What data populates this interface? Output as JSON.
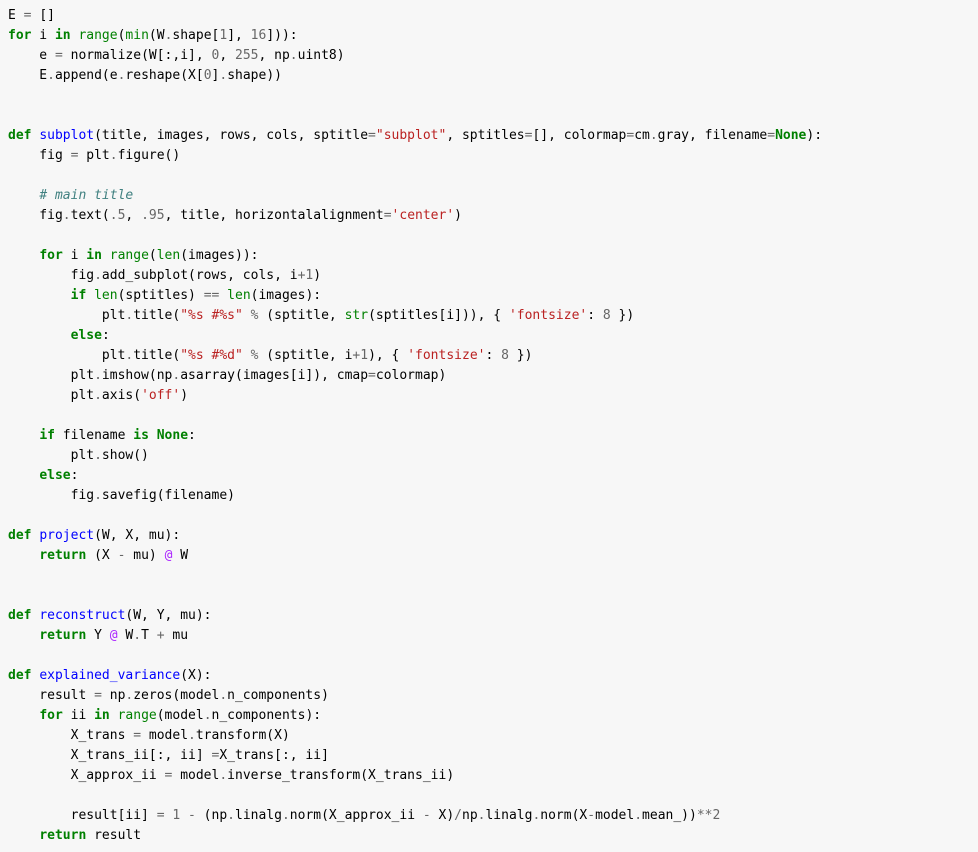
{
  "code": {
    "lines": [
      [
        [
          "",
          "E "
        ],
        [
          "op",
          "= "
        ],
        [
          "pun",
          "[]"
        ]
      ],
      [
        [
          "kw",
          "for"
        ],
        [
          "",
          " i "
        ],
        [
          "kw",
          "in"
        ],
        [
          "",
          " "
        ],
        [
          "bi",
          "range"
        ],
        [
          "pun",
          "("
        ],
        [
          "bi",
          "min"
        ],
        [
          "pun",
          "(W"
        ],
        [
          "op",
          "."
        ],
        [
          "pun",
          "shape["
        ],
        [
          "num",
          "1"
        ],
        [
          "pun",
          "], "
        ],
        [
          "num",
          "16"
        ],
        [
          "pun",
          "])):"
        ]
      ],
      [
        [
          "",
          "    e "
        ],
        [
          "op",
          "= "
        ],
        [
          "pun",
          "normalize(W[:,i], "
        ],
        [
          "num",
          "0"
        ],
        [
          "pun",
          ", "
        ],
        [
          "num",
          "255"
        ],
        [
          "pun",
          ", np"
        ],
        [
          "op",
          "."
        ],
        [
          "pun",
          "uint8)"
        ]
      ],
      [
        [
          "",
          "    E"
        ],
        [
          "op",
          "."
        ],
        [
          "pun",
          "append(e"
        ],
        [
          "op",
          "."
        ],
        [
          "pun",
          "reshape(X["
        ],
        [
          "num",
          "0"
        ],
        [
          "pun",
          "]"
        ],
        [
          "op",
          "."
        ],
        [
          "pun",
          "shape))"
        ]
      ],
      [
        [
          "",
          ""
        ]
      ],
      [
        [
          "",
          ""
        ]
      ],
      [
        [
          "kw",
          "def"
        ],
        [
          "",
          " "
        ],
        [
          "fun",
          "subplot"
        ],
        [
          "pun",
          "(title, images, rows, cols, sptitle"
        ],
        [
          "op",
          "="
        ],
        [
          "str",
          "\"subplot\""
        ],
        [
          "pun",
          ", sptitles"
        ],
        [
          "op",
          "="
        ],
        [
          "pun",
          "[], colormap"
        ],
        [
          "op",
          "="
        ],
        [
          "pun",
          "cm"
        ],
        [
          "op",
          "."
        ],
        [
          "pun",
          "gray, filename"
        ],
        [
          "op",
          "="
        ],
        [
          "cn",
          "None"
        ],
        [
          "pun",
          "):"
        ]
      ],
      [
        [
          "",
          "    fig "
        ],
        [
          "op",
          "= "
        ],
        [
          "pun",
          "plt"
        ],
        [
          "op",
          "."
        ],
        [
          "pun",
          "figure()"
        ]
      ],
      [
        [
          "",
          ""
        ]
      ],
      [
        [
          "",
          "    "
        ],
        [
          "com",
          "# main title"
        ]
      ],
      [
        [
          "",
          "    fig"
        ],
        [
          "op",
          "."
        ],
        [
          "pun",
          "text("
        ],
        [
          "num",
          ".5"
        ],
        [
          "pun",
          ", "
        ],
        [
          "num",
          ".95"
        ],
        [
          "pun",
          ", title, horizontalalignment"
        ],
        [
          "op",
          "="
        ],
        [
          "str",
          "'center'"
        ],
        [
          "pun",
          ")"
        ]
      ],
      [
        [
          "",
          ""
        ]
      ],
      [
        [
          "",
          "    "
        ],
        [
          "kw",
          "for"
        ],
        [
          "",
          " i "
        ],
        [
          "kw",
          "in"
        ],
        [
          "",
          " "
        ],
        [
          "bi",
          "range"
        ],
        [
          "pun",
          "("
        ],
        [
          "bi",
          "len"
        ],
        [
          "pun",
          "(images)):"
        ]
      ],
      [
        [
          "",
          "        fig"
        ],
        [
          "op",
          "."
        ],
        [
          "pun",
          "add_subplot(rows, cols, i"
        ],
        [
          "op",
          "+"
        ],
        [
          "num",
          "1"
        ],
        [
          "pun",
          ")"
        ]
      ],
      [
        [
          "",
          "        "
        ],
        [
          "kw",
          "if"
        ],
        [
          "",
          " "
        ],
        [
          "bi",
          "len"
        ],
        [
          "pun",
          "(sptitles) "
        ],
        [
          "op",
          "== "
        ],
        [
          "bi",
          "len"
        ],
        [
          "pun",
          "(images):"
        ]
      ],
      [
        [
          "",
          "            plt"
        ],
        [
          "op",
          "."
        ],
        [
          "pun",
          "title("
        ],
        [
          "str",
          "\"%s #%s\""
        ],
        [
          "",
          " "
        ],
        [
          "op",
          "%"
        ],
        [
          "",
          " (sptitle, "
        ],
        [
          "bi",
          "str"
        ],
        [
          "pun",
          "(sptitles[i])), { "
        ],
        [
          "str",
          "'fontsize'"
        ],
        [
          "pun",
          ": "
        ],
        [
          "num",
          "8"
        ],
        [
          "pun",
          " })"
        ]
      ],
      [
        [
          "",
          "        "
        ],
        [
          "kw",
          "else"
        ],
        [
          "pun",
          ":"
        ]
      ],
      [
        [
          "",
          "            plt"
        ],
        [
          "op",
          "."
        ],
        [
          "pun",
          "title("
        ],
        [
          "str",
          "\"%s #%d\""
        ],
        [
          "",
          " "
        ],
        [
          "op",
          "%"
        ],
        [
          "",
          " (sptitle, i"
        ],
        [
          "op",
          "+"
        ],
        [
          "num",
          "1"
        ],
        [
          "pun",
          "), { "
        ],
        [
          "str",
          "'fontsize'"
        ],
        [
          "pun",
          ": "
        ],
        [
          "num",
          "8"
        ],
        [
          "pun",
          " })"
        ]
      ],
      [
        [
          "",
          "        plt"
        ],
        [
          "op",
          "."
        ],
        [
          "pun",
          "imshow(np"
        ],
        [
          "op",
          "."
        ],
        [
          "pun",
          "asarray(images[i]), cmap"
        ],
        [
          "op",
          "="
        ],
        [
          "pun",
          "colormap)"
        ]
      ],
      [
        [
          "",
          "        plt"
        ],
        [
          "op",
          "."
        ],
        [
          "pun",
          "axis("
        ],
        [
          "str",
          "'off'"
        ],
        [
          "pun",
          ")"
        ]
      ],
      [
        [
          "",
          ""
        ]
      ],
      [
        [
          "",
          "    "
        ],
        [
          "kw",
          "if"
        ],
        [
          "",
          " filename "
        ],
        [
          "kw",
          "is"
        ],
        [
          "",
          " "
        ],
        [
          "cn",
          "None"
        ],
        [
          "pun",
          ":"
        ]
      ],
      [
        [
          "",
          "        plt"
        ],
        [
          "op",
          "."
        ],
        [
          "pun",
          "show()"
        ]
      ],
      [
        [
          "",
          "    "
        ],
        [
          "kw",
          "else"
        ],
        [
          "pun",
          ":"
        ]
      ],
      [
        [
          "",
          "        fig"
        ],
        [
          "op",
          "."
        ],
        [
          "pun",
          "savefig(filename)"
        ]
      ],
      [
        [
          "",
          ""
        ]
      ],
      [
        [
          "kw",
          "def"
        ],
        [
          "",
          " "
        ],
        [
          "fun",
          "project"
        ],
        [
          "pun",
          "(W, X, mu):"
        ]
      ],
      [
        [
          "",
          "    "
        ],
        [
          "kw",
          "return"
        ],
        [
          "",
          " (X "
        ],
        [
          "op",
          "-"
        ],
        [
          "",
          " mu) "
        ],
        [
          "dec",
          "@"
        ],
        [
          "",
          " W"
        ]
      ],
      [
        [
          "",
          ""
        ]
      ],
      [
        [
          "",
          ""
        ]
      ],
      [
        [
          "kw",
          "def"
        ],
        [
          "",
          " "
        ],
        [
          "fun",
          "reconstruct"
        ],
        [
          "pun",
          "(W, Y, mu):"
        ]
      ],
      [
        [
          "",
          "    "
        ],
        [
          "kw",
          "return"
        ],
        [
          "",
          " Y "
        ],
        [
          "dec",
          "@"
        ],
        [
          "",
          " W"
        ],
        [
          "op",
          "."
        ],
        [
          "pun",
          "T "
        ],
        [
          "op",
          "+"
        ],
        [
          "",
          " mu"
        ]
      ],
      [
        [
          "",
          ""
        ]
      ],
      [
        [
          "kw",
          "def"
        ],
        [
          "",
          " "
        ],
        [
          "fun",
          "explained_variance"
        ],
        [
          "pun",
          "(X):"
        ]
      ],
      [
        [
          "",
          "    result "
        ],
        [
          "op",
          "= "
        ],
        [
          "pun",
          "np"
        ],
        [
          "op",
          "."
        ],
        [
          "pun",
          "zeros(model"
        ],
        [
          "op",
          "."
        ],
        [
          "pun",
          "n_components)"
        ]
      ],
      [
        [
          "",
          "    "
        ],
        [
          "kw",
          "for"
        ],
        [
          "",
          " ii "
        ],
        [
          "kw",
          "in"
        ],
        [
          "",
          " "
        ],
        [
          "bi",
          "range"
        ],
        [
          "pun",
          "(model"
        ],
        [
          "op",
          "."
        ],
        [
          "pun",
          "n_components):"
        ]
      ],
      [
        [
          "",
          "        X_trans "
        ],
        [
          "op",
          "= "
        ],
        [
          "pun",
          "model"
        ],
        [
          "op",
          "."
        ],
        [
          "pun",
          "transform(X)"
        ]
      ],
      [
        [
          "",
          "        X_trans_ii[:, ii] "
        ],
        [
          "op",
          "="
        ],
        [
          "pun",
          "X_trans[:, ii]"
        ]
      ],
      [
        [
          "",
          "        X_approx_ii "
        ],
        [
          "op",
          "= "
        ],
        [
          "pun",
          "model"
        ],
        [
          "op",
          "."
        ],
        [
          "pun",
          "inverse_transform(X_trans_ii)"
        ]
      ],
      [
        [
          "",
          ""
        ]
      ],
      [
        [
          "",
          "        result[ii] "
        ],
        [
          "op",
          "= "
        ],
        [
          "num",
          "1"
        ],
        [
          "",
          " "
        ],
        [
          "op",
          "-"
        ],
        [
          "",
          " (np"
        ],
        [
          "op",
          "."
        ],
        [
          "pun",
          "linalg"
        ],
        [
          "op",
          "."
        ],
        [
          "pun",
          "norm(X_approx_ii "
        ],
        [
          "op",
          "-"
        ],
        [
          "",
          " X)"
        ],
        [
          "op",
          "/"
        ],
        [
          "pun",
          "np"
        ],
        [
          "op",
          "."
        ],
        [
          "pun",
          "linalg"
        ],
        [
          "op",
          "."
        ],
        [
          "pun",
          "norm(X"
        ],
        [
          "op",
          "-"
        ],
        [
          "pun",
          "model"
        ],
        [
          "op",
          "."
        ],
        [
          "pun",
          "mean_))"
        ],
        [
          "op",
          "**"
        ],
        [
          "num",
          "2"
        ]
      ],
      [
        [
          "",
          "    "
        ],
        [
          "kw",
          "return"
        ],
        [
          "",
          " result"
        ]
      ]
    ]
  }
}
